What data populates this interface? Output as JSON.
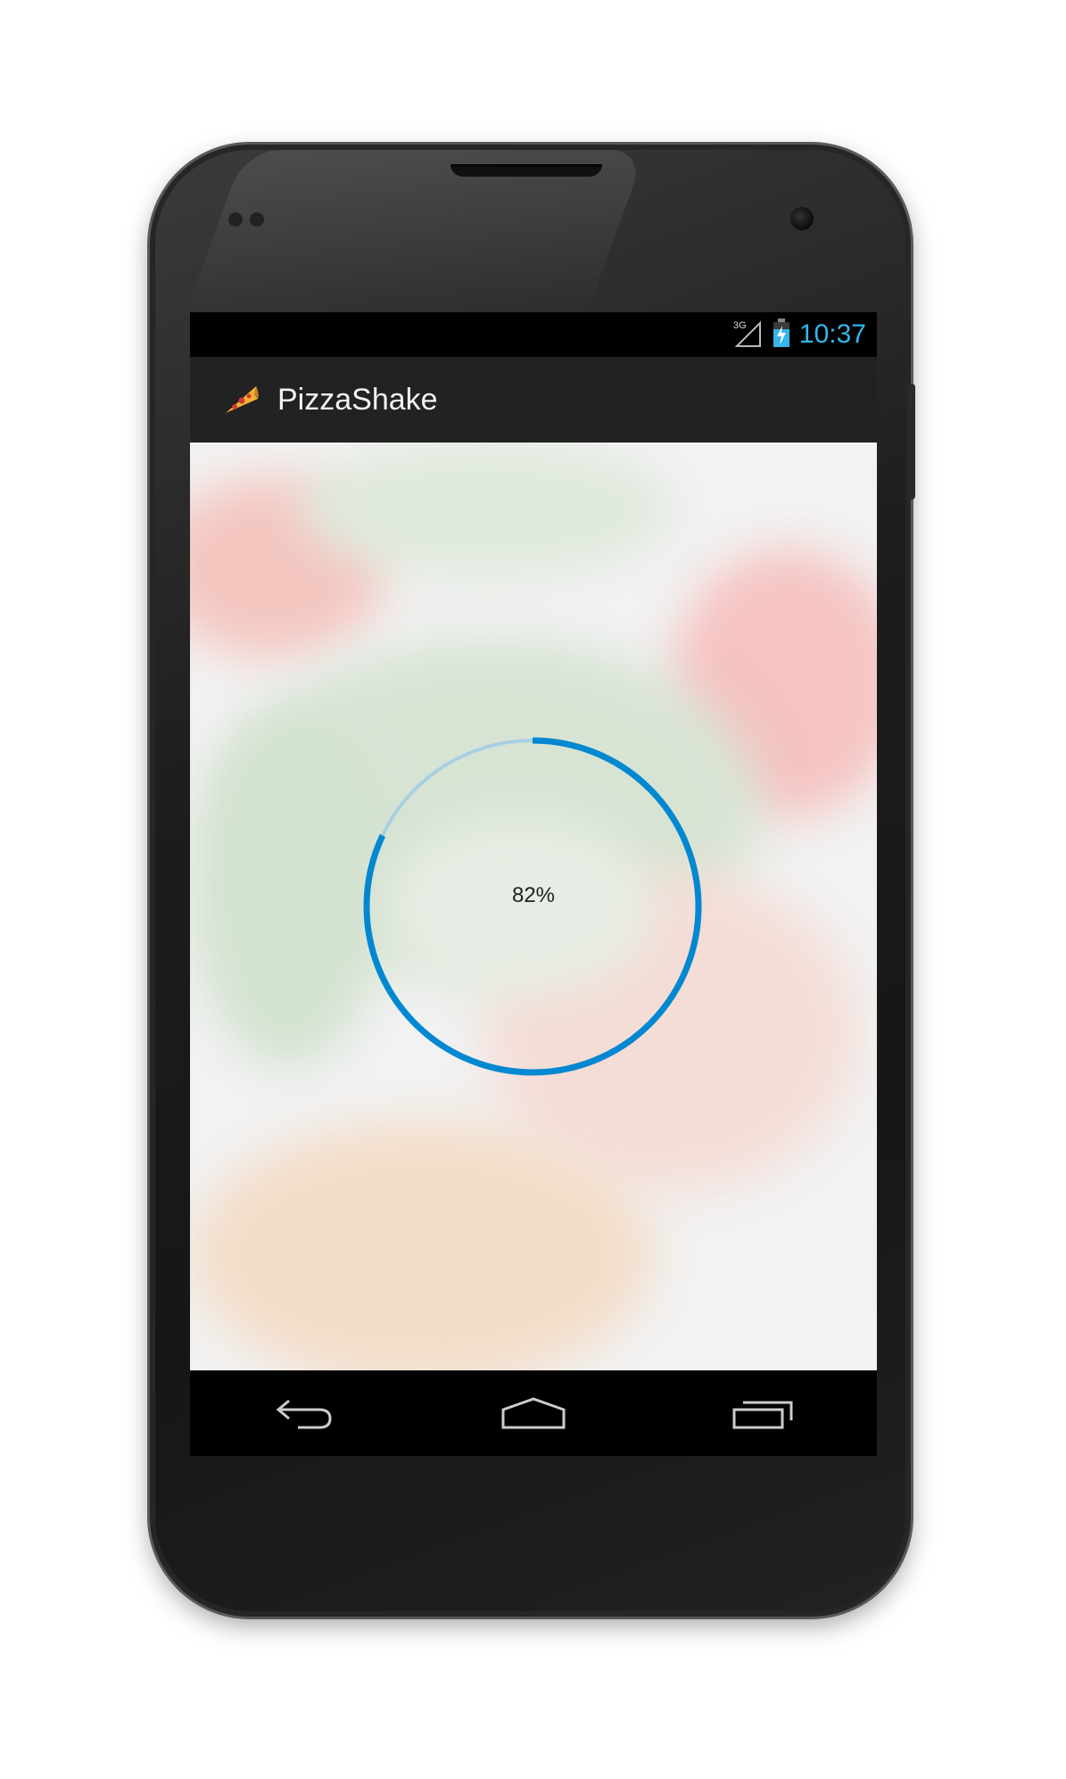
{
  "status_bar": {
    "time": "10:37",
    "network": "3G",
    "icons": [
      "signal-icon",
      "battery-charging-icon"
    ]
  },
  "action_bar": {
    "title": "PizzaShake",
    "icon": "pizza-slice-icon"
  },
  "progress": {
    "value": 0.82,
    "label": "82%",
    "colors": {
      "arc": "#0288d1",
      "track": "#a8cfe2"
    }
  },
  "navigation_bar": {
    "buttons": [
      "back-icon",
      "home-icon",
      "recent-apps-icon"
    ]
  },
  "colors": {
    "clock": "#35b5ea",
    "action_bar": "#222222"
  }
}
